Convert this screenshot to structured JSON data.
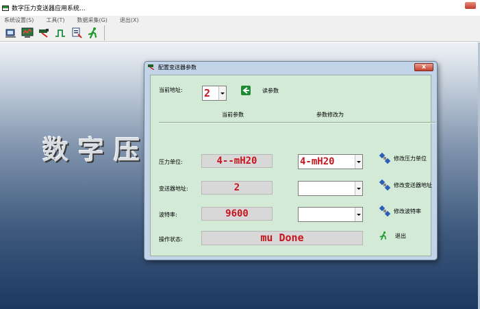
{
  "app": {
    "title": "数字压力变送器应用系统..."
  },
  "menu": {
    "items": [
      "系统设置(S)",
      "工具(T)",
      "数据采集(G)",
      "退出(X)"
    ]
  },
  "toolbar": {
    "icons": [
      "config-transmitter-icon",
      "monitor-icon",
      "chart-icon",
      "pulse-icon",
      "data-icon",
      "exit-running-man-icon"
    ]
  },
  "workspace": {
    "banner": "数字压力变送器应用系统"
  },
  "dialog": {
    "title": "配置变送器参数",
    "close_glyph": "x",
    "address_label": "当前地址:",
    "address_value": "2",
    "read_button_label": "读参数",
    "col_current": "当前参数",
    "col_modify": "参数修改为",
    "rows": {
      "unit": {
        "label": "压力单位:",
        "current": "4--mH20",
        "new": "4-mH20",
        "action": "修改压力单位"
      },
      "addr": {
        "label": "变送器地址:",
        "current": "2",
        "new": "",
        "action": "修改变送器地址"
      },
      "baud": {
        "label": "波特率:",
        "current": "9600",
        "new": "",
        "action": "修改波特率"
      }
    },
    "status_label": "操作状态:",
    "status_value": "mu Done",
    "exit_label": "退出"
  },
  "colors": {
    "value_red": "#c8141e",
    "dialog_client": "#d2ead6",
    "dialog_frame": "#c2d5e8",
    "read_only_field": "#d8d8d8"
  }
}
